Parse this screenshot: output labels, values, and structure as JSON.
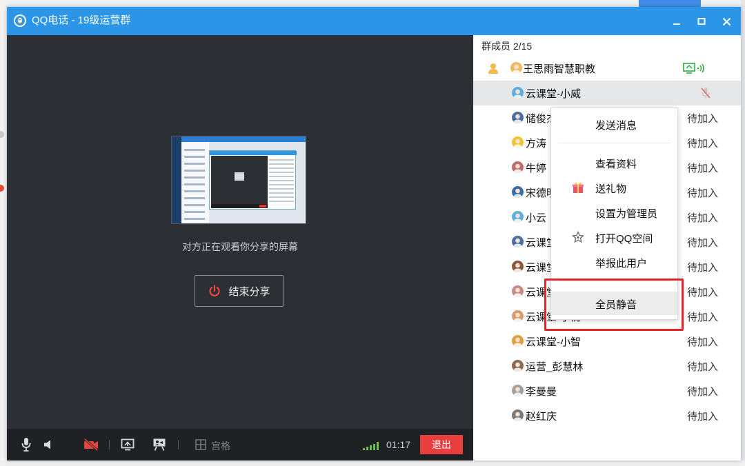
{
  "window": {
    "title": "QQ电话 - 19级运营群"
  },
  "video": {
    "share_text": "对方正在观看你分享的屏幕",
    "end_share_label": "结束分享"
  },
  "toolbar": {
    "grid_label": "宫格",
    "timer": "01:17",
    "exit_label": "退出"
  },
  "members": {
    "count_label": "群成员 2/15",
    "list": [
      {
        "name": "王思雨智慧职教",
        "status": "",
        "avatar": "#f0b860"
      },
      {
        "name": "云课堂-小威",
        "status": "",
        "avatar": "#5bb0e0"
      },
      {
        "name": "储俊杰",
        "status": "待加入",
        "avatar": "#4a6fa5"
      },
      {
        "name": "方涛",
        "status": "待加入",
        "avatar": "#f1c232"
      },
      {
        "name": "牛婷",
        "status": "待加入",
        "avatar": "#c26b6b"
      },
      {
        "name": "宋德明",
        "status": "待加入",
        "avatar": "#3b6ea8"
      },
      {
        "name": "小云",
        "status": "待加入",
        "avatar": "#5bb0e0"
      },
      {
        "name": "云课堂-沈",
        "status": "待加入",
        "avatar": "#4a6fa5"
      },
      {
        "name": "云课堂-王瑞",
        "status": "待加入",
        "avatar": "#8a5a3c"
      },
      {
        "name": "云课堂-小何",
        "status": "待加入",
        "avatar": "#c98a8a"
      },
      {
        "name": "云课堂-小倩",
        "status": "待加入",
        "avatar": "#d99a6c"
      },
      {
        "name": "云课堂-小智",
        "status": "待加入",
        "avatar": "#e0a040"
      },
      {
        "name": "运营_彭慧林",
        "status": "待加入",
        "avatar": "#8a6a55"
      },
      {
        "name": "李曼曼",
        "status": "待加入",
        "avatar": "#a0a0a0"
      },
      {
        "name": "赵红庆",
        "status": "待加入",
        "avatar": "#7a7a7a"
      }
    ]
  },
  "context_menu": {
    "items": [
      {
        "label": "发送消息",
        "icon": ""
      },
      {
        "label": "查看资料",
        "icon": ""
      },
      {
        "label": "送礼物",
        "icon": "gift-icon"
      },
      {
        "label": "设置为管理员",
        "icon": ""
      },
      {
        "label": "打开QQ空间",
        "icon": "star-icon"
      },
      {
        "label": "举报此用户",
        "icon": ""
      },
      {
        "label": "全员静音",
        "icon": ""
      }
    ]
  },
  "colors": {
    "titlebar": "#2b96e8",
    "video_bg": "#2c2f33",
    "toolbar_bg": "#1f2124",
    "exit_red": "#e83e3e",
    "highlight_red": "#e3242b",
    "signal_green": "#6cc04a"
  }
}
